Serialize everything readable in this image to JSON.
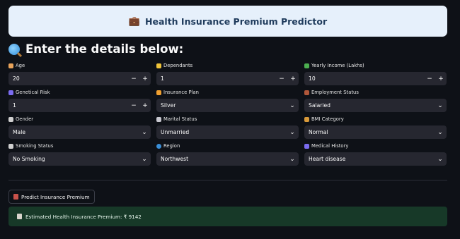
{
  "banner": {
    "icon": "briefcase-icon",
    "title": "Health Insurance Premium Predictor"
  },
  "heading": {
    "icon": "magnifier-icon",
    "text": "Enter the details below:"
  },
  "fields": {
    "age": {
      "label": "Age",
      "value": "20",
      "icon": "cake-icon",
      "icon_color": "#e8a35a"
    },
    "dependants": {
      "label": "Dependants",
      "value": "1",
      "icon": "family-icon",
      "icon_color": "#f0c43a"
    },
    "yearly_income": {
      "label": "Yearly Income (Lakhs)",
      "value": "10",
      "icon": "money-icon",
      "icon_color": "#4caf50"
    },
    "genetical_risk": {
      "label": "Genetical Risk",
      "value": "1",
      "icon": "dna-icon",
      "icon_color": "#7b6cf0"
    },
    "insurance_plan": {
      "label": "Insurance Plan",
      "value": "Silver",
      "icon": "medal-icon",
      "icon_color": "#f0a030"
    },
    "employment_status": {
      "label": "Employment Status",
      "value": "Salaried",
      "icon": "briefcase-icon",
      "icon_color": "#b0573a"
    },
    "gender": {
      "label": "Gender",
      "value": "Male",
      "icon": "gender-icon",
      "icon_color": "#d0d0d0"
    },
    "marital_status": {
      "label": "Marital Status",
      "value": "Unmarried",
      "icon": "ring-icon",
      "icon_color": "#c8c8d0"
    },
    "bmi_category": {
      "label": "BMI Category",
      "value": "Normal",
      "icon": "scale-icon",
      "icon_color": "#d89a3a"
    },
    "smoking_status": {
      "label": "Smoking Status",
      "value": "No Smoking",
      "icon": "cigarette-icon",
      "icon_color": "#d0d0d0"
    },
    "region": {
      "label": "Region",
      "value": "Northwest",
      "icon": "globe-icon",
      "icon_color": "#3a8fd8"
    },
    "medical_history": {
      "label": "Medical History",
      "value": "Heart disease",
      "icon": "heartbeat-icon",
      "icon_color": "#7b6cf0"
    }
  },
  "stepper": {
    "minus": "−",
    "plus": "+"
  },
  "predict_button": {
    "icon": "book-icon",
    "label": "Predict Insurance Premium"
  },
  "result": {
    "icon": "receipt-icon",
    "text": "Estimated Health Insurance Premium: ₹ 9142"
  }
}
